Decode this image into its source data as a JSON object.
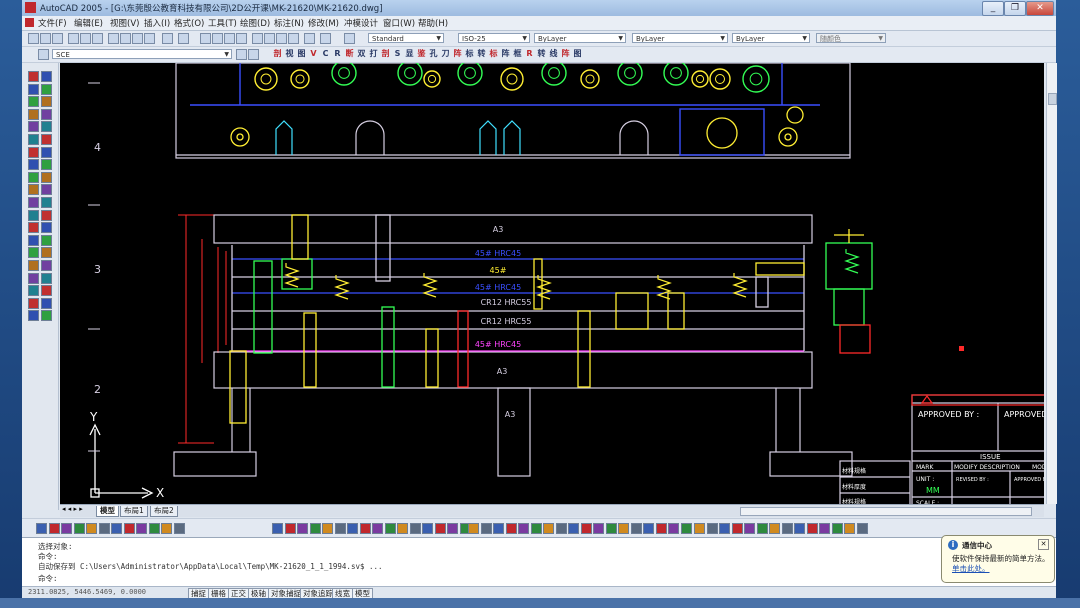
{
  "window": {
    "title": "AutoCAD 2005 - [G:\\东莞殷公教育科技有限公司\\2D公开课\\MK-21620\\MK-21620.dwg]",
    "minimize": "_",
    "restore": "❐",
    "close": "✕"
  },
  "menu": [
    "文件(F)",
    "编辑(E)",
    "视图(V)",
    "插入(I)",
    "格式(O)",
    "工具(T)",
    "绘图(D)",
    "标注(N)",
    "修改(M)",
    "冲模设计",
    "窗口(W)",
    "帮助(H)"
  ],
  "toolbar1": {
    "text_style": "Standard",
    "dim_style": "ISO-25",
    "layer": "ByLayer",
    "linetype": "ByLayer",
    "lineweight": "ByLayer",
    "plotstyle": "随颜色"
  },
  "toolbar2": {
    "layer_combo": "SCE",
    "die_tools": [
      "剖",
      "视",
      "图",
      "V",
      "C",
      "R",
      "断",
      "双",
      "打",
      "剖",
      "S",
      "显",
      "鉴",
      "孔",
      "刀",
      "阵",
      "标",
      "转",
      "标",
      "阵",
      "框",
      "R",
      "转",
      "线",
      "阵",
      "图"
    ]
  },
  "drawing": {
    "row_labels": [
      "4",
      "3",
      "2"
    ],
    "plates": {
      "top": "A3",
      "p1": "45# HRC45",
      "p2": "45#",
      "p3": "45# HRC45",
      "p4": "CR12  HRC55",
      "p5": "CR12  HRC55",
      "p6": "45# HRC45",
      "bottom": "A3",
      "foot": "A3"
    },
    "axis_y": "Y",
    "axis_x": "X",
    "title_block": {
      "approved1": "APPROVED BY :",
      "approved2": "APPROVED BY :",
      "issue": "ISSUE",
      "mark": "MARK",
      "modify": "MODIFY DESCRIPTION",
      "mod": "MODI",
      "unit": "UNIT :",
      "unit_value": "MM",
      "revised": "REVISED BY :",
      "approved3": "APPROVED BY :",
      "scale": "SCALE :",
      "side1": "材料规格",
      "side2": "材料厚度",
      "side3": "材料规格"
    }
  },
  "tabs": [
    "模型",
    "布局1",
    "布局2"
  ],
  "command_lines": [
    "选择对象:",
    "命令:",
    "自动保存到 C:\\Users\\Administrator\\AppData\\Local\\Temp\\MK-21620_1_1_1994.sv$ ...",
    "命令:"
  ],
  "status": {
    "coords": "2311.0825, 5446.5469, 0.0000",
    "toggles": [
      "捕捉",
      "栅格",
      "正交",
      "极轴",
      "对象捕捉",
      "对象追踪",
      "线宽",
      "模型"
    ]
  },
  "notification": {
    "title": "通信中心",
    "body": "使软件保持最新的简单方法。",
    "link": "单击此处。",
    "close": "✕"
  },
  "colors": {
    "canvas": "#000000",
    "outline": "#d6cfe2",
    "blue": "#3a4fff",
    "yellow": "#ffee33",
    "red": "#ff2a2a",
    "green": "#33ff55",
    "magenta": "#ff44ff",
    "cyan": "#40e0ff"
  }
}
